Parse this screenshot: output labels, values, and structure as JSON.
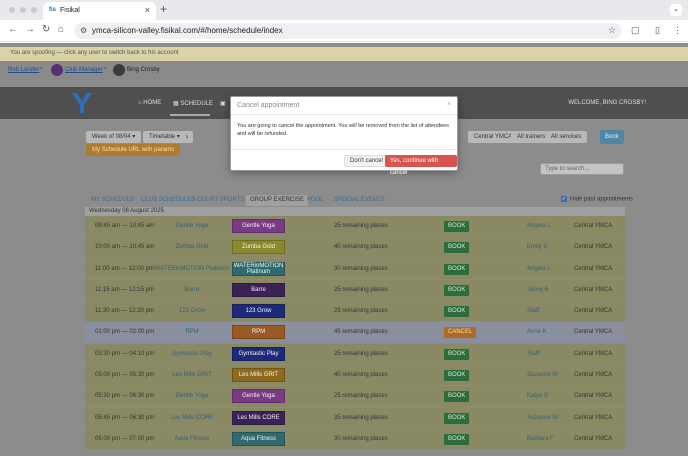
{
  "browser": {
    "tab_title": "Fisikal",
    "tab_favicon": "fis",
    "url": "ymca-silicon-valley.fisikal.com/#/home/schedule/index"
  },
  "spoof_banner": "You are spoofing — click any user to switch back to his account",
  "breadcrumb": {
    "user": "Rob Lander",
    "role": "Club Manager",
    "current": "Bing Crosby"
  },
  "topnav": {
    "home": "Home",
    "schedule": "Schedule",
    "welcome": "Welcome, Bing Crosby!"
  },
  "filters": {
    "week": "Week of 08/04",
    "view": "Timetable",
    "next": "›",
    "location": "Central YMCA",
    "trainers": "All trainers",
    "services": "All services",
    "book": "Book",
    "schedule_url": "My Schedule URL with params",
    "search_placeholder": "Type to search..."
  },
  "tabs": [
    "My Schedule",
    "Club Schedules",
    "Court Sports",
    "Group Exercise",
    "Pool",
    "Special Events"
  ],
  "hide_past": "Hide past appointments",
  "date_header": "Wednesday 06 August 2025",
  "rows": [
    {
      "time": "09:45 am — 10:45 am",
      "class": "Gentle Yoga",
      "pill": "Gentle Yoga",
      "color": "#7b3a86",
      "places": "25 remaining places",
      "action": "BOOK",
      "trainer": "Angela L",
      "location": "Central YMCA"
    },
    {
      "time": "10:00 am — 10:45 am",
      "class": "Zumba Gold",
      "pill": "Zumba Gold",
      "color": "#8a8a2c",
      "places": "40 remaining places",
      "action": "BOOK",
      "trainer": "Emily S",
      "location": "Central YMCA"
    },
    {
      "time": "11:00 am — 12:00 pm",
      "class": "WATERinMOTION Platinum",
      "pill": "WATERinMOTION Platinum",
      "color": "#2e6a6f",
      "places": "30 remaining places",
      "action": "BOOK",
      "trainer": "Angela L",
      "location": "Central YMCA"
    },
    {
      "time": "11:15 am — 12:15 pm",
      "class": "Barre",
      "pill": "Barre",
      "color": "#3b2256",
      "places": "25 remaining places",
      "action": "BOOK",
      "trainer": "Jenny B",
      "location": "Central YMCA"
    },
    {
      "time": "11:30 am — 12:30 pm",
      "class": "123 Grow",
      "pill": "123 Grow",
      "color": "#1e2a78",
      "places": "25 remaining places",
      "action": "BOOK",
      "trainer": "Staff",
      "location": "Central YMCA"
    },
    {
      "time": "01:00 pm — 02:00 pm",
      "class": "RPM",
      "pill": "RPM",
      "color": "#9a5a24",
      "places": "45 remaining places",
      "action": "CANCEL",
      "trainer": "Anne K",
      "location": "Central YMCA"
    },
    {
      "time": "03:30 pm — 04:10 pm",
      "class": "Gymtastic Play",
      "pill": "Gymtastic Play",
      "color": "#1e2a78",
      "places": "25 remaining places",
      "action": "BOOK",
      "trainer": "Staff",
      "location": "Central YMCA"
    },
    {
      "time": "05:00 pm — 05:30 pm",
      "class": "Les Mills GRIT",
      "pill": "Les Mills GRIT",
      "color": "#8e6a1e",
      "places": "40 remaining places",
      "action": "BOOK",
      "trainer": "Suzanne W",
      "location": "Central YMCA"
    },
    {
      "time": "05:30 pm — 06:30 pm",
      "class": "Gentle Yoga",
      "pill": "Gentle Yoga",
      "color": "#7b3a86",
      "places": "25 remaining places",
      "action": "BOOK",
      "trainer": "Katya S",
      "location": "Central YMCA"
    },
    {
      "time": "05:45 pm — 06:30 pm",
      "class": "Les Mills CORE",
      "pill": "Les Mills CORE",
      "color": "#3b2256",
      "places": "35 remaining places",
      "action": "BOOK",
      "trainer": "Suzanne W",
      "location": "Central YMCA"
    },
    {
      "time": "06:00 pm — 07:00 pm",
      "class": "Aqua Fitness",
      "pill": "Aqua Fitness",
      "color": "#2e6a6f",
      "places": "30 remaining places",
      "action": "BOOK",
      "trainer": "Barbara F",
      "location": "Central YMCA"
    }
  ],
  "modal": {
    "title": "Cancel appointment",
    "close": "×",
    "body": "You are going to cancel the appointment. You will be removed from the list of attendees and will be refunded.",
    "dont_cancel": "Don't cancel",
    "confirm": "Yes, continue with cancel"
  }
}
